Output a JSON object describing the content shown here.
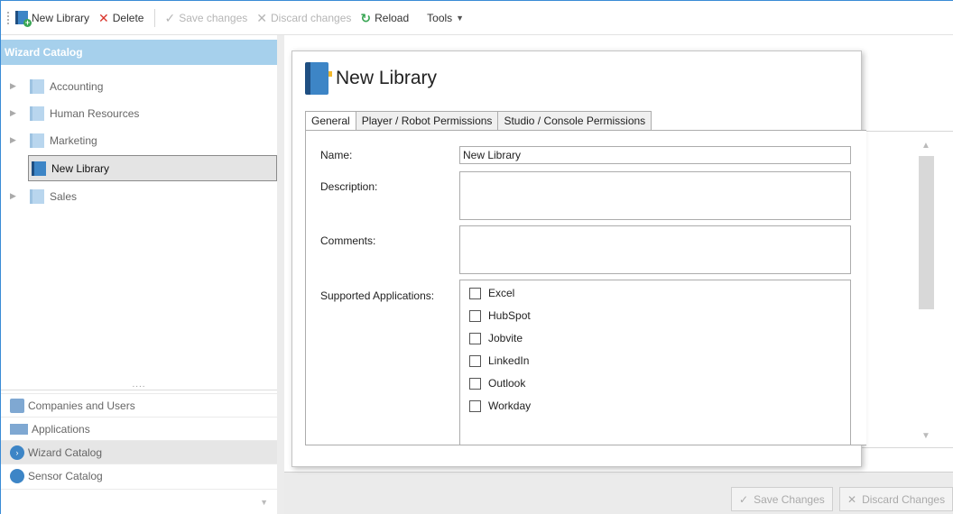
{
  "toolbar": {
    "new_library": "New Library",
    "delete": "Delete",
    "save_changes": "Save changes",
    "discard_changes": "Discard changes",
    "reload": "Reload",
    "tools": "Tools"
  },
  "left": {
    "header": "Wizard Catalog",
    "tree": [
      {
        "label": "Accounting"
      },
      {
        "label": "Human Resources"
      },
      {
        "label": "Marketing"
      },
      {
        "label": "New Library"
      },
      {
        "label": "Sales"
      }
    ],
    "grip": "....",
    "nav": [
      {
        "label": "Companies and Users"
      },
      {
        "label": "Applications"
      },
      {
        "label": "Wizard Catalog"
      },
      {
        "label": "Sensor Catalog"
      }
    ]
  },
  "dialog": {
    "title": "New Library",
    "tabs": [
      "General",
      "Player / Robot Permissions",
      "Studio / Console Permissions"
    ],
    "labels": {
      "name": "Name:",
      "description": "Description:",
      "comments": "Comments:",
      "supported_apps": "Supported Applications:"
    },
    "name_value": "New Library",
    "description_value": "",
    "comments_value": "",
    "apps": [
      "Excel",
      "HubSpot",
      "Jobvite",
      "LinkedIn",
      "Outlook",
      "Workday"
    ]
  },
  "footer": {
    "save": "Save Changes",
    "discard": "Discard Changes"
  },
  "colors": {
    "accent": "#3a8bd6",
    "header_bg": "#a6d0ec",
    "delete_red": "#d9342b",
    "reload_green": "#3aa655"
  }
}
